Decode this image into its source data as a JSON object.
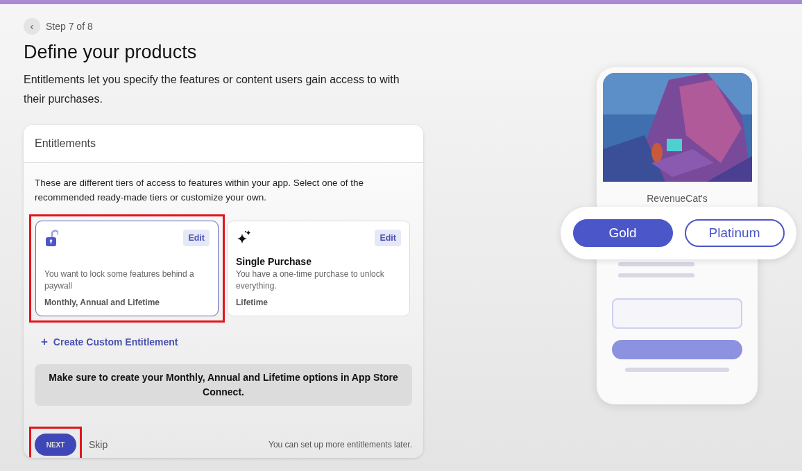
{
  "step": {
    "back_icon": "‹",
    "label": "Step 7 of 8"
  },
  "title": "Define your products",
  "subtitle": "Entitlements let you specify the features or content users gain access to with their purchases.",
  "card": {
    "header": "Entitlements",
    "intro": "These are different tiers of access to features within your app. Select one of the recommended ready-made tiers or customize your own.",
    "tiers": [
      {
        "kind": "lock",
        "description": "You want to lock some features behind a paywall",
        "products": "Monthly, Annual and Lifetime",
        "edit": "Edit",
        "selected": true,
        "highlighted": true
      },
      {
        "kind": "sparkle",
        "title": "Single Purchase",
        "description": "You have a one-time purchase to unlock everything.",
        "products": "Lifetime",
        "edit": "Edit",
        "selected": false,
        "highlighted": false
      }
    ],
    "custom_link": {
      "icon": "+",
      "label": "Create Custom Entitlement"
    },
    "notice": "Make sure to create your Monthly, Annual and Lifetime options in App Store Connect.",
    "next": {
      "label": "NEXT",
      "highlighted": true
    },
    "skip": "Skip",
    "footnote": "You can set up more entitlements later."
  },
  "preview": {
    "kind": "picture",
    "app_name": "RevenueCat's",
    "tiers": [
      {
        "label": "Gold",
        "selected": true
      },
      {
        "label": "Platinum",
        "selected": false
      }
    ]
  }
}
